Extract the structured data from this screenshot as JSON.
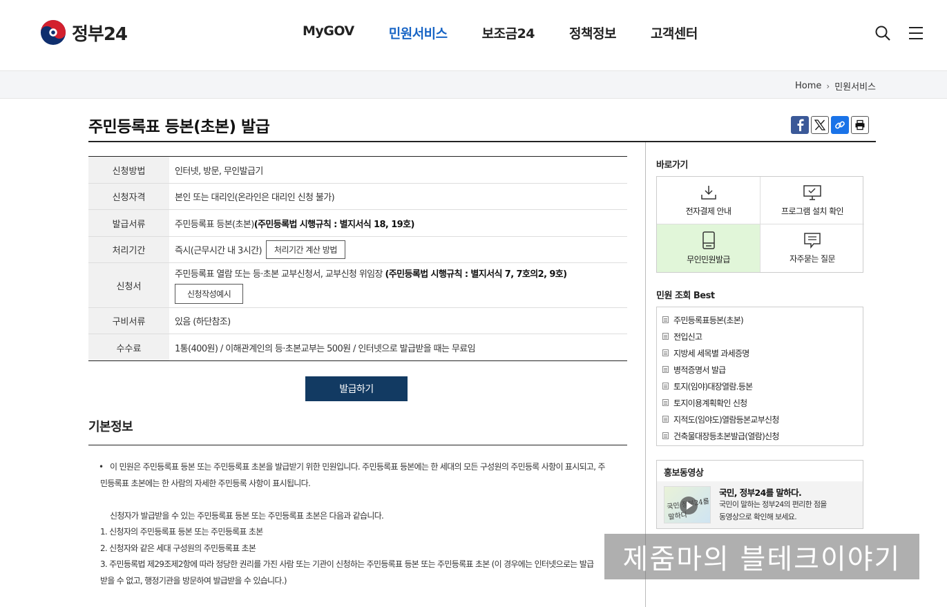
{
  "brand": {
    "logo_text": "정부24"
  },
  "nav": [
    "MyGOV",
    "민원서비스",
    "보조금24",
    "정책정보",
    "고객센터"
  ],
  "breadcrumb": {
    "home": "Home",
    "current": "민원서비스"
  },
  "page_title": "주민등록표 등본(초본) 발급",
  "info_rows": [
    {
      "label": "신청방법",
      "value": "인터넷, 방문, 무인발급기"
    },
    {
      "label": "신청자격",
      "value": "본인 또는 대리인(온라인은 대리인 신청 불가)"
    },
    {
      "label": "발급서류",
      "value": "주민등록표 등본(초본) ",
      "bold": "(주민등록법 시행규칙 : 별지서식 18, 19호)"
    },
    {
      "label": "처리기간",
      "value": "즉시(근무시간 내 3시간)",
      "button": "처리기간 계산 방법"
    },
    {
      "label": "신청서",
      "value": "주민등록표 열람 또는 등·초본 교부신청서, 교부신청 위임장 ",
      "bold": "(주민등록법 시행규칙 : 별지서식 7, 7호의2, 9호)",
      "button": "신청작성예시"
    },
    {
      "label": "구비서류",
      "value": "있음 (하단참조)"
    },
    {
      "label": "수수료",
      "value": "1통(400원) / 이해관계인의 등·초본교부는 500원 / 인터넷으로 발급받을 때는 무료임"
    }
  ],
  "issue_button": "발급하기",
  "basic_info": {
    "title": "기본정보",
    "line1": "이 민원은 주민등록표 등본 또는 주민등록표 초본을 발급받기 위한 민원입니다. 주민등록표 등본에는 한 세대의 모든 구성원의 주민등록 사항이 표시되고, 주",
    "line2": "민등록표 초본에는 한 사람의 자세한 주민등록 사항이 표시됩니다.",
    "line3": "신청자가 발급받을 수 있는 주민등록표 등본 또는 주민등록표 초본은 다음과 같습니다.",
    "line4": "1. 신청자의 주민등록표 등본 또는 주민등록표 초본",
    "line5": "2. 신청자와 같은 세대 구성원의 주민등록표 초본",
    "line6": "3. 주민등록법 제29조제2항에 따라 정당한 권리를 가진 사람 또는 기관이 신청하는 주민등록표 등본 또는 주민등록표 초본 (이 경우에는 인터넷으로는 발급",
    "line7": "받을 수 없고, 행정기관을 방문하여 발급받을 수 있습니다.)"
  },
  "sidebar": {
    "quick_title": "바로가기",
    "quick": [
      "전자결제 안내",
      "프로그램 설치 확인",
      "무인민원발급",
      "자주묻는 질문"
    ],
    "best_title": "민원 조회 Best",
    "best": [
      "주민등록표등본(초본)",
      "전입신고",
      "지방세 세목별 과세증명",
      "병적증명서 발급",
      "토지(임야)대장열람.등본",
      "토지이용계획확인 신청",
      "지적도(임야도)열람등본교부신청",
      "건축물대장등초본발급(열람)신청"
    ],
    "promo_title": "홍보동영상",
    "promo_headline": "국민, 정부24를 말하다.",
    "promo_desc1": "국민이 말하는 정부24의 편리한 점을",
    "promo_desc2": "동영상으로 확인해 보세요.",
    "promo_thumb_text": "국민 정부24를 말하다"
  },
  "watermark": "제줌마의 블테크이야기",
  "colors": {
    "nav_active": "#1764c5",
    "issue_button": "#123a62",
    "highlight": "#e1f6d9",
    "facebook": "#3b5998",
    "link": "#1a73e8"
  }
}
